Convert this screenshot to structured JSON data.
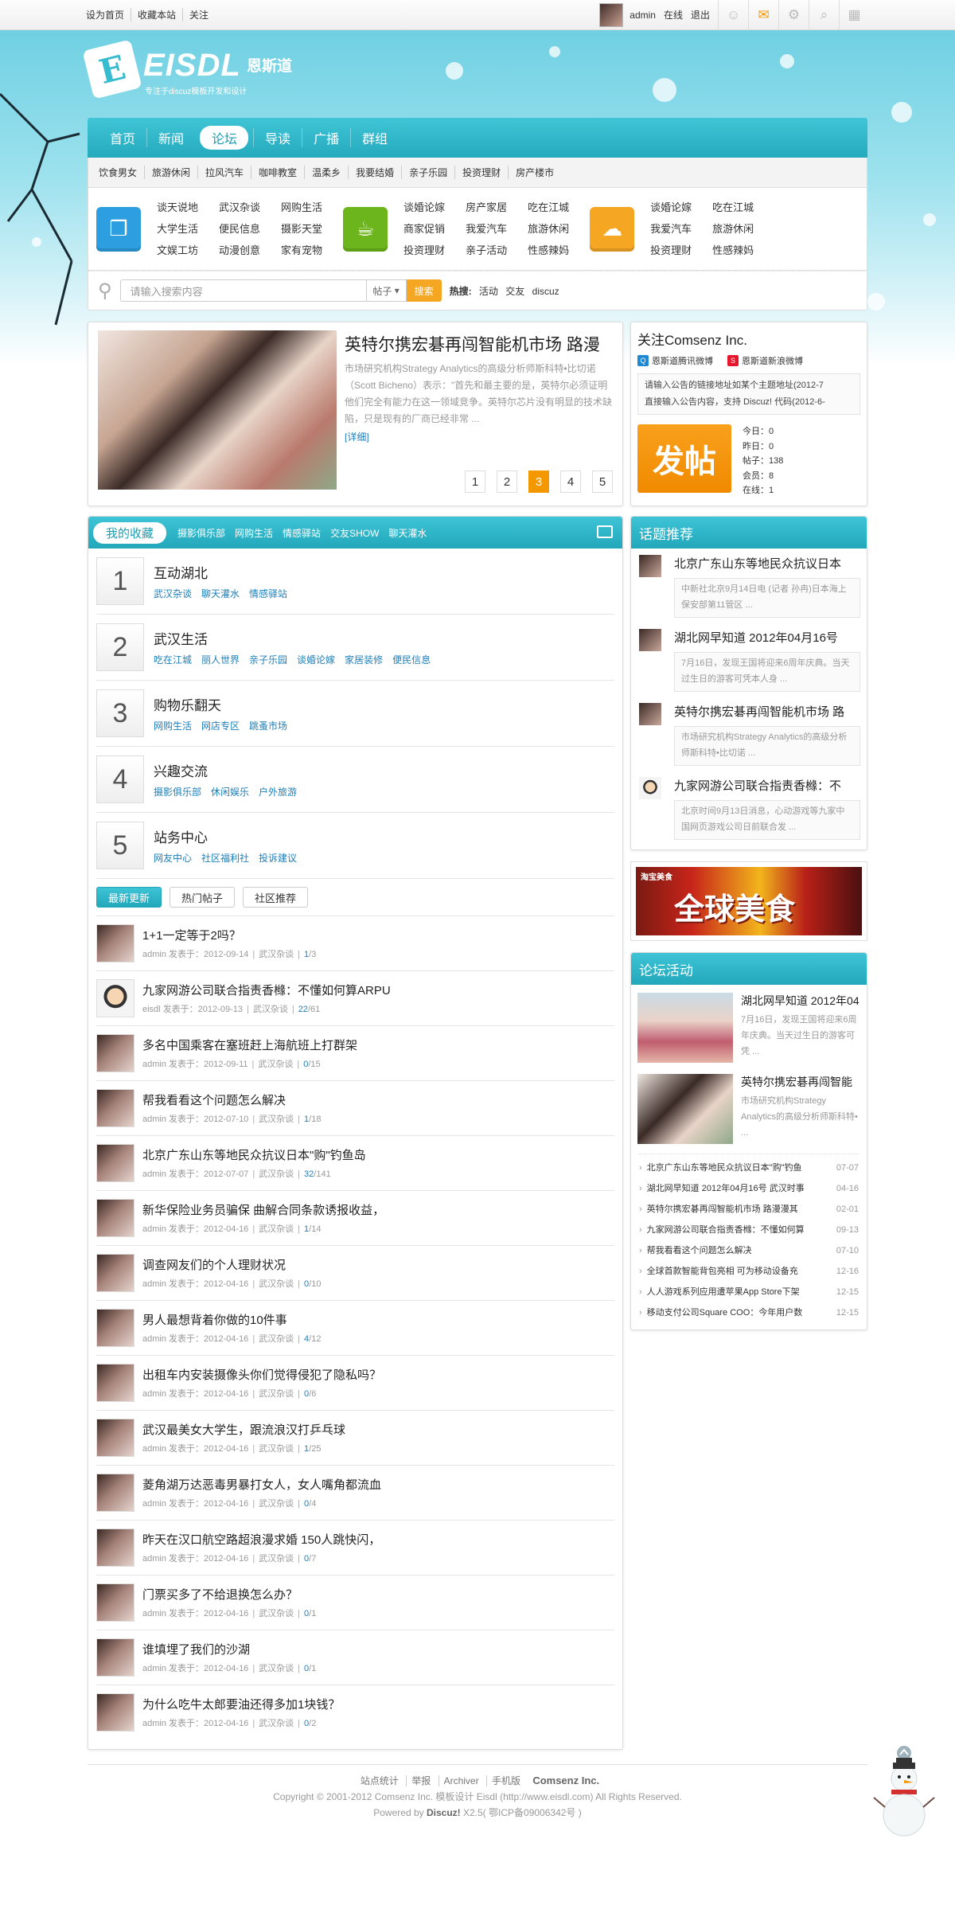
{
  "topbar": {
    "links": [
      "设为首页",
      "收藏本站",
      "关注"
    ],
    "user": "admin",
    "status": "在线",
    "logout": "退出"
  },
  "logo": {
    "brand": "EISDL",
    "cn": "恩斯道",
    "slogan": "专注于discuz模板开发和设计"
  },
  "nav": {
    "items": [
      "首页",
      "新闻",
      "论坛",
      "导读",
      "广播",
      "群组"
    ],
    "active_index": 2
  },
  "subnav": [
    "饮食男女",
    "旅游休闲",
    "拉风汽车",
    "咖啡教室",
    "温柔乡",
    "我要结婚",
    "亲子乐园",
    "投资理财",
    "房产楼市"
  ],
  "categories": [
    {
      "icon": "cube-icon",
      "color": "#2d9ee0",
      "cols": [
        [
          "谈天说地",
          "大学生活",
          "文娱工坊"
        ],
        [
          "武汉杂谈",
          "便民信息",
          "动漫创意"
        ],
        [
          "网购生活",
          "摄影天堂",
          "家有宠物"
        ]
      ]
    },
    {
      "icon": "cup-icon",
      "color": "#6cb51c",
      "cols": [
        [
          "谈婚论嫁",
          "商家促销",
          "投资理财"
        ],
        [
          "房产家居",
          "我爱汽车",
          "亲子活动"
        ],
        [
          "吃在江城",
          "旅游休闲",
          "性感辣妈"
        ]
      ]
    },
    {
      "icon": "cloud-icon",
      "color": "#f5a623",
      "cols": [
        [
          "谈婚论嫁",
          "我爱汽车",
          "投资理财"
        ],
        [
          "吃在江城",
          "旅游休闲",
          "性感辣妈"
        ]
      ]
    }
  ],
  "search": {
    "placeholder": "请输入搜索内容",
    "type": "帖子",
    "button": "搜索",
    "hot_label": "热搜:",
    "hot": [
      "活动",
      "交友",
      "discuz"
    ]
  },
  "feature": {
    "title": "英特尔携宏碁再闯智能机市场 路漫",
    "desc": "市场研究机构Strategy Analytics的高级分析师斯科特•比切诺（Scott Bicheno）表示：\"首先和最主要的是，英特尔必须证明他们完全有能力在这一领域竞争。英特尔芯片没有明显的技术缺陷，只是现有的厂商已经非常 ...",
    "more": "[详细]",
    "pages": [
      "1",
      "2",
      "3",
      "4",
      "5"
    ],
    "active_page": 2
  },
  "follow": {
    "title": "关注Comsenz Inc.",
    "weibo_tencent": "恩斯道腾讯微博",
    "weibo_sina": "恩斯道新浪微博",
    "notices": [
      "请输入公告的链接地址如某个主题地址(2012-7",
      "直接输入公告内容，支持 Discuz! 代码(2012-6-"
    ],
    "post_button": "发帖",
    "stats": [
      "今日：0",
      "昨日：0",
      "帖子：138",
      "会员：8",
      "在线：1"
    ]
  },
  "favorites": {
    "title": "我的收藏",
    "tabs": [
      "摄影俱乐部",
      "网购生活",
      "情感驿站",
      "交友SHOW",
      "聊天灌水"
    ],
    "forums": [
      {
        "num": "1",
        "name": "互动湖北",
        "links": [
          "武汉杂谈",
          "聊天灌水",
          "情感驿站"
        ]
      },
      {
        "num": "2",
        "name": "武汉生活",
        "links": [
          "吃在江城",
          "丽人世界",
          "亲子乐园",
          "谈婚论嫁",
          "家居装修",
          "便民信息"
        ]
      },
      {
        "num": "3",
        "name": "购物乐翻天",
        "links": [
          "网购生活",
          "网店专区",
          "跳蚤市场"
        ]
      },
      {
        "num": "4",
        "name": "兴趣交流",
        "links": [
          "摄影俱乐部",
          "休闲娱乐",
          "户外旅游"
        ]
      },
      {
        "num": "5",
        "name": "站务中心",
        "links": [
          "网友中心",
          "社区福利社",
          "投诉建议"
        ]
      }
    ]
  },
  "threads": {
    "tabs": [
      "最新更新",
      "热门帖子",
      "社区推荐"
    ],
    "posted_label": "发表于：",
    "items": [
      {
        "title": "1+1一定等于2吗？",
        "author": "admin",
        "date": "2012-09-14",
        "forum": "武汉杂谈",
        "replies": "1",
        "views": "3"
      },
      {
        "title": "九家网游公司联合指责香橼：不懂如何算ARPU",
        "author": "eisdl",
        "date": "2012-09-13",
        "forum": "武汉杂谈",
        "replies": "22",
        "views": "61",
        "cartoon": true
      },
      {
        "title": "多名中国乘客在塞班赶上海航班上打群架",
        "author": "admin",
        "date": "2012-09-11",
        "forum": "武汉杂谈",
        "replies": "0",
        "views": "15"
      },
      {
        "title": "帮我看看这个问题怎么解决",
        "author": "admin",
        "date": "2012-07-10",
        "forum": "武汉杂谈",
        "replies": "1",
        "views": "18"
      },
      {
        "title": "北京广东山东等地民众抗议日本\"购\"钓鱼岛",
        "author": "admin",
        "date": "2012-07-07",
        "forum": "武汉杂谈",
        "replies": "32",
        "views": "141"
      },
      {
        "title": "新华保险业务员骗保 曲解合同条款诱报收益，",
        "author": "admin",
        "date": "2012-04-16",
        "forum": "武汉杂谈",
        "replies": "1",
        "views": "14"
      },
      {
        "title": "调查网友们的个人理财状况",
        "author": "admin",
        "date": "2012-04-16",
        "forum": "武汉杂谈",
        "replies": "0",
        "views": "10"
      },
      {
        "title": "男人最想背着你做的10件事",
        "author": "admin",
        "date": "2012-04-16",
        "forum": "武汉杂谈",
        "replies": "4",
        "views": "12"
      },
      {
        "title": "出租车内安装摄像头你们觉得侵犯了隐私吗？",
        "author": "admin",
        "date": "2012-04-16",
        "forum": "武汉杂谈",
        "replies": "0",
        "views": "6"
      },
      {
        "title": "武汉最美女大学生，跟流浪汉打乒乓球",
        "author": "admin",
        "date": "2012-04-16",
        "forum": "武汉杂谈",
        "replies": "1",
        "views": "25"
      },
      {
        "title": "菱角湖万达恶毒男暴打女人，女人嘴角都流血",
        "author": "admin",
        "date": "2012-04-16",
        "forum": "武汉杂谈",
        "replies": "0",
        "views": "4"
      },
      {
        "title": "昨天在汉口航空路超浪漫求婚 150人跳快闪，",
        "author": "admin",
        "date": "2012-04-16",
        "forum": "武汉杂谈",
        "replies": "0",
        "views": "7"
      },
      {
        "title": "门票买多了不给退换怎么办？",
        "author": "admin",
        "date": "2012-04-16",
        "forum": "武汉杂谈",
        "replies": "0",
        "views": "1"
      },
      {
        "title": "谁填埋了我们的沙湖",
        "author": "admin",
        "date": "2012-04-16",
        "forum": "武汉杂谈",
        "replies": "0",
        "views": "1"
      },
      {
        "title": "为什么吃牛太郎要油还得多加1块钱？",
        "author": "admin",
        "date": "2012-04-16",
        "forum": "武汉杂谈",
        "replies": "0",
        "views": "2"
      }
    ]
  },
  "topics": {
    "title": "话题推荐",
    "items": [
      {
        "title": "北京广东山东等地民众抗议日本",
        "desc": "中新社北京9月14日电 (记者 孙冉)日本海上保安部第11管区 ..."
      },
      {
        "title": "湖北网早知道 2012年04月16号",
        "desc": "7月16日，发现王国将迎来6周年庆典。当天过生日的游客可凭本人身 ..."
      },
      {
        "title": "英特尔携宏碁再闯智能机市场 路",
        "desc": "市场研究机构Strategy Analytics的高级分析师斯科特•比切诺 ..."
      },
      {
        "title": "九家网游公司联合指责香橼：不",
        "desc": "北京时间9月13日消息，心动游戏等九家中国网页游戏公司日前联合发 ...",
        "cartoon": true
      }
    ]
  },
  "ad": {
    "small": "淘宝美食",
    "big": "全球美食"
  },
  "activities": {
    "title": "论坛活动",
    "cards": [
      {
        "title": "湖北网早知道 2012年04",
        "desc": "7月16日，发现王国将迎来6周年庆典。当天过生日的游客可凭 ..."
      },
      {
        "title": "英特尔携宏碁再闯智能",
        "desc": "市场研究机构Strategy Analytics的高级分析师斯科特• ..."
      }
    ],
    "list": [
      {
        "title": "北京广东山东等地民众抗议日本\"购\"钓鱼",
        "date": "07-07"
      },
      {
        "title": "湖北网早知道 2012年04月16号 武汉时事",
        "date": "04-16"
      },
      {
        "title": "英特尔携宏碁再闯智能机市场 路漫漫其",
        "date": "02-01"
      },
      {
        "title": "九家网游公司联合指责香橼：不懂如何算",
        "date": "09-13"
      },
      {
        "title": "帮我看看这个问题怎么解决",
        "date": "07-10"
      },
      {
        "title": "全球首款智能背包亮相 可为移动设备充",
        "date": "12-16"
      },
      {
        "title": "人人游戏系列应用遭苹果App Store下架",
        "date": "12-15"
      },
      {
        "title": "移动支付公司Square COO：今年用户数",
        "date": "12-15"
      }
    ]
  },
  "footer": {
    "links": [
      "站点统计",
      "举报",
      "Archiver",
      "手机版"
    ],
    "company": "Comsenz Inc.",
    "copyright": "Copyright © 2001-2012 Comsenz Inc. 模板设计 Eisdl (http://www.eisdl.com) All Rights Reserved.",
    "powered_prefix": "Powered by",
    "powered_name": "Discuz!",
    "powered_suffix": "X2.5( 鄂ICP备09006342号 )"
  },
  "colors": {
    "accent": "#25a9bd",
    "orange": "#f39800",
    "link": "#1e7fb8"
  }
}
